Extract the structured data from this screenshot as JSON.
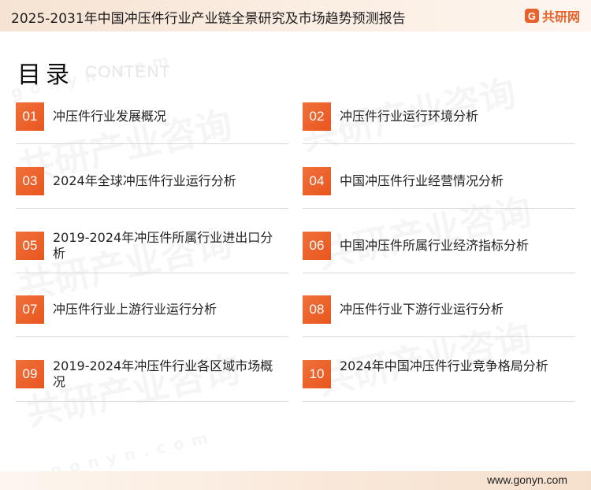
{
  "header": {
    "title": "2025-2031年中国冲压件行业产业链全景研究及市场趋势预测报告",
    "brand_icon": "G",
    "brand_name": "共研网"
  },
  "watermark": {
    "text": "共研产业咨询",
    "sub": "gonyn.com"
  },
  "toc": {
    "title": "目录",
    "subtitle": "CONTENT",
    "items": [
      {
        "num": "01",
        "label": "冲压件行业发展概况"
      },
      {
        "num": "02",
        "label": "冲压件行业运行环境分析"
      },
      {
        "num": "03",
        "label": "2024年全球冲压件行业运行分析"
      },
      {
        "num": "04",
        "label": "中国冲压件行业经营情况分析"
      },
      {
        "num": "05",
        "label": "2019-2024年冲压件所属行业进出口分析"
      },
      {
        "num": "06",
        "label": "中国冲压件所属行业经济指标分析"
      },
      {
        "num": "07",
        "label": "冲压件行业上游行业运行分析"
      },
      {
        "num": "08",
        "label": "冲压件行业下游行业运行分析"
      },
      {
        "num": "09",
        "label": "2019-2024年冲压件行业各区域市场概况"
      },
      {
        "num": "10",
        "label": "2024年中国冲压件行业竞争格局分析"
      }
    ]
  },
  "footer": {
    "url": "www.gonyn.com"
  },
  "colors": {
    "accent": "#e9561f",
    "brand": "#e8632b"
  }
}
